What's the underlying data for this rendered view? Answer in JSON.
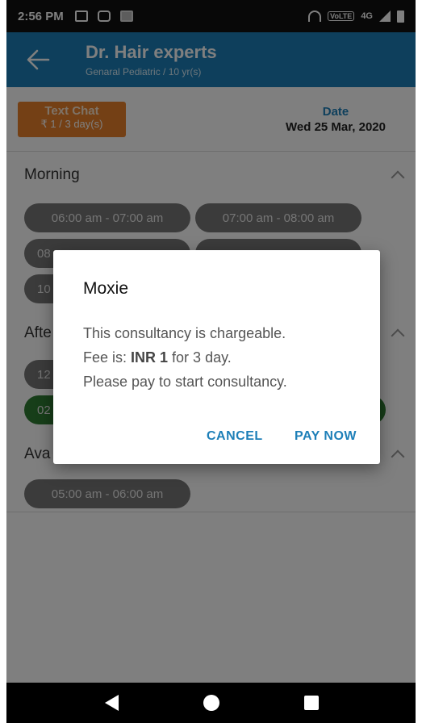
{
  "status_bar": {
    "time": "2:56 PM",
    "network": "4G",
    "volte": "VoLTE"
  },
  "app_bar": {
    "title": "Dr. Hair experts",
    "subtitle": "Genaral Pediatric / 10 yr(s)"
  },
  "plan": {
    "title": "Text Chat",
    "price": "₹ 1 / 3 day(s)"
  },
  "date": {
    "label": "Date",
    "value": "Wed 25 Mar, 2020"
  },
  "sections": {
    "morning": {
      "title": "Morning",
      "slots": [
        "06:00 am - 07:00 am",
        "07:00 am - 08:00 am",
        "08",
        "10"
      ]
    },
    "afternoon": {
      "title": "Afte",
      "slots": [
        "12",
        "02"
      ]
    },
    "available": {
      "title": "Ava",
      "slots": [
        "05:00 am - 06:00 am"
      ]
    }
  },
  "dialog": {
    "title": "Moxie",
    "line1": "This consultancy is chargeable.",
    "fee_prefix": "Fee is: ",
    "fee_value": "INR 1",
    "fee_suffix": " for 3 day.",
    "line3": "Please pay to start consultancy.",
    "cancel_label": "CANCEL",
    "pay_label": "PAY NOW"
  },
  "colors": {
    "primary": "#1d7fb8",
    "badge": "#e8812a",
    "slot": "#767676",
    "slot_selected": "#2e7d32"
  }
}
